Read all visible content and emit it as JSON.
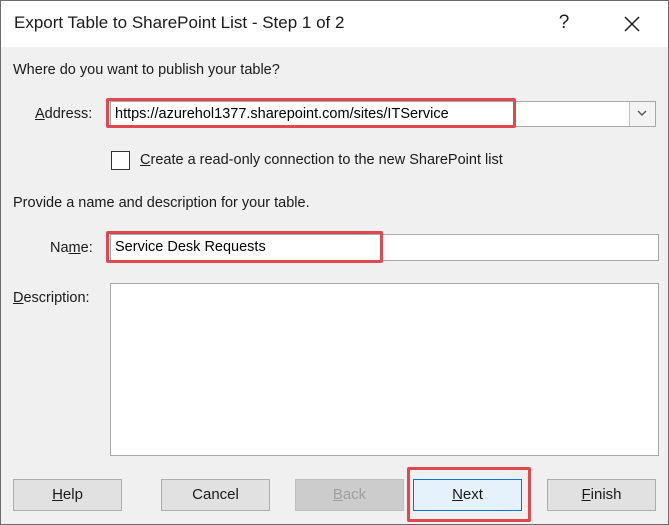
{
  "window": {
    "title": "Export Table to SharePoint List - Step 1 of 2",
    "help_glyph": "?",
    "close_icon": "close-icon"
  },
  "publish": {
    "prompt": "Where do you want to publish your table?",
    "address_label_pre": "",
    "address_label_accel": "A",
    "address_label_post": "ddress:",
    "address_value": "https://azurehol1377.sharepoint.com/sites/ITService",
    "readonly_checked": false,
    "readonly_label_accel": "C",
    "readonly_label_rest": "reate a read-only connection to the new SharePoint list"
  },
  "details": {
    "prompt": "Provide a name and description for your table.",
    "name_label_pre": "Na",
    "name_label_accel": "m",
    "name_label_post": "e:",
    "name_value": "Service Desk Requests",
    "description_label_accel": "D",
    "description_label_rest": "escription:",
    "description_value": ""
  },
  "buttons": {
    "help_accel": "H",
    "help_rest": "elp",
    "cancel": "Cancel",
    "back_accel": "B",
    "back_rest": "ack",
    "next_accel": "N",
    "next_rest": "ext",
    "finish_accel": "F",
    "finish_rest": "inish"
  },
  "colors": {
    "highlight": "#e0484f",
    "default_button_border": "#0078d7"
  }
}
